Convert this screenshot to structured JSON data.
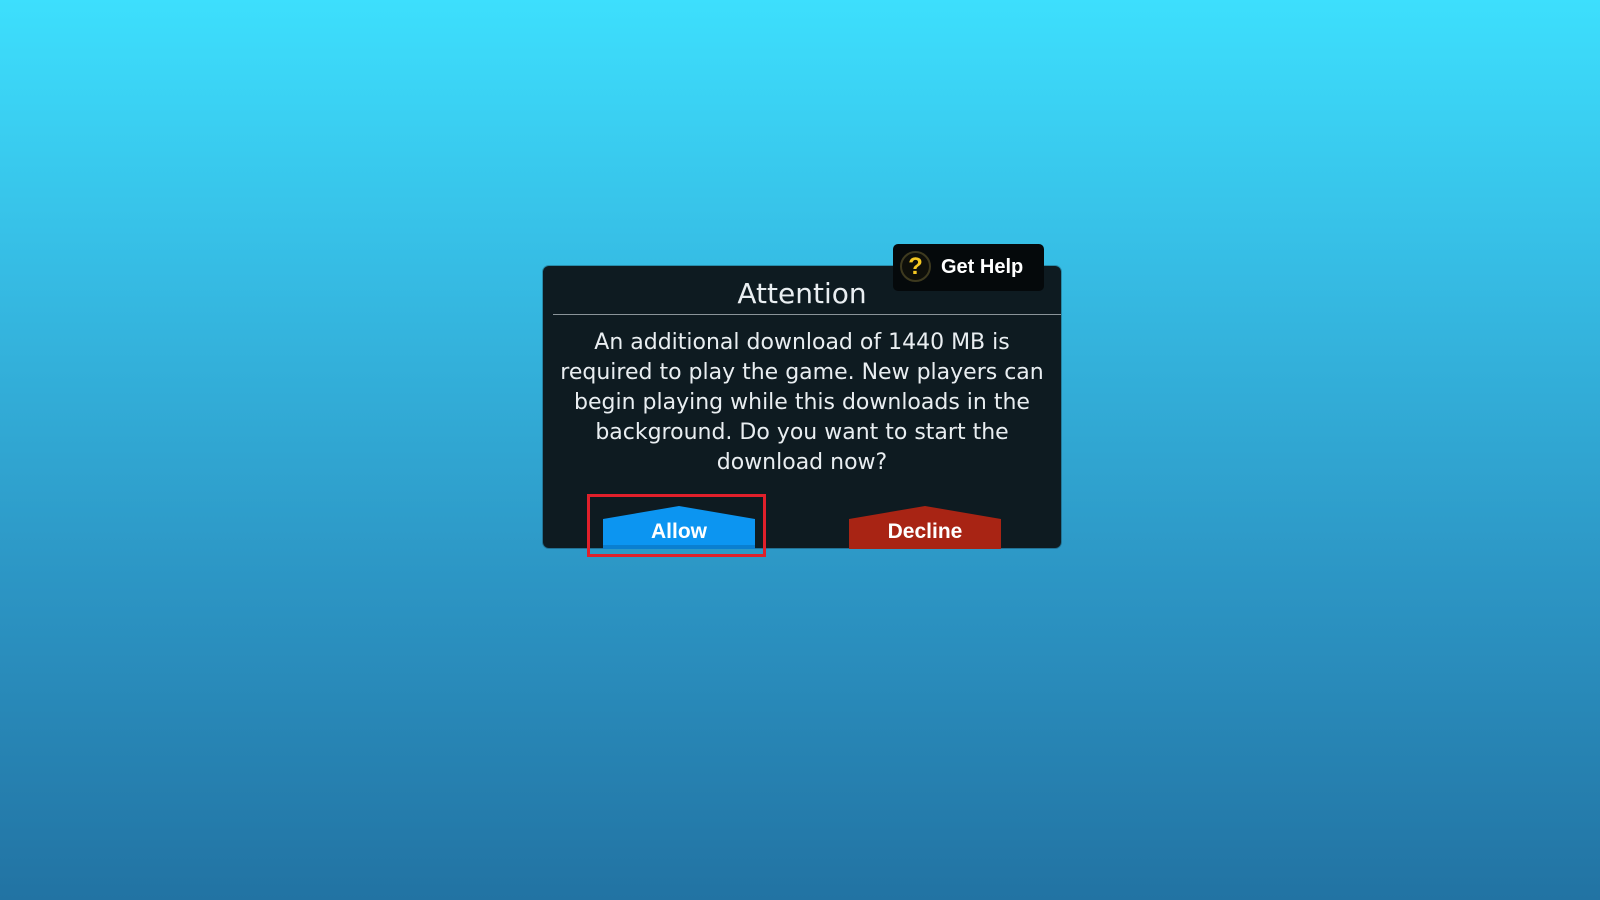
{
  "dialog": {
    "title": "Attention",
    "message": "An additional download of 1440 MB is required to play the game. New players can begin playing while this downloads in the background. Do you want to start the download now?"
  },
  "help": {
    "label": "Get Help",
    "icon": "question-icon",
    "icon_glyph": "?"
  },
  "buttons": {
    "allow_label": "Allow",
    "decline_label": "Decline"
  },
  "colors": {
    "background_top": "#3DDFFD",
    "background_bottom": "#2273A3",
    "dialog_bg": "#0E1B21",
    "allow": "#0C95F1",
    "decline": "#A82414",
    "highlight": "#E0202B",
    "help_icon": "#F4C722"
  }
}
